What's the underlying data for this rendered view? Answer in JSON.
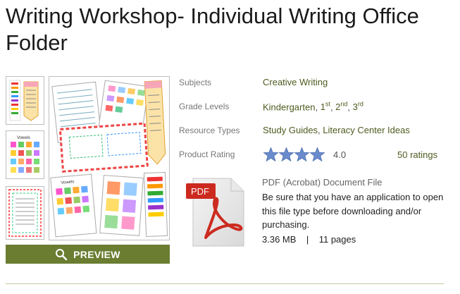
{
  "product": {
    "title": "Writing Workshop- Individual Writing Office Folder"
  },
  "preview": {
    "label": "PREVIEW",
    "icon": "magnifier-icon"
  },
  "details": {
    "subjects_label": "Subjects",
    "subjects_value": "Creative Writing",
    "grade_label": "Grade Levels",
    "grades": {
      "k": "Kindergarten",
      "g1_num": "1",
      "g1_sup": "st",
      "g2_num": "2",
      "g2_sup": "nd",
      "g3_num": "3",
      "g3_sup": "rd",
      "sep": ", "
    },
    "types_label": "Resource Types",
    "types": [
      "Study Guides",
      "Literacy Center Ideas"
    ],
    "rating_label": "Product Rating",
    "rating_value": "4.0",
    "rating_stars": 4,
    "ratings_count": "50 ratings"
  },
  "file": {
    "icon_text": "PDF",
    "type": "PDF (Acrobat) Document File",
    "description": "Be sure that you have an application to open this file type before downloading and/or purchasing.",
    "size": "3.36 MB",
    "separator": "|",
    "pages": "11 pages"
  },
  "colors": {
    "accent_green": "#6a7d31",
    "link_green": "#4d5b1f",
    "star_blue": "#6b8ccc",
    "pdf_red": "#cc2a1f"
  }
}
